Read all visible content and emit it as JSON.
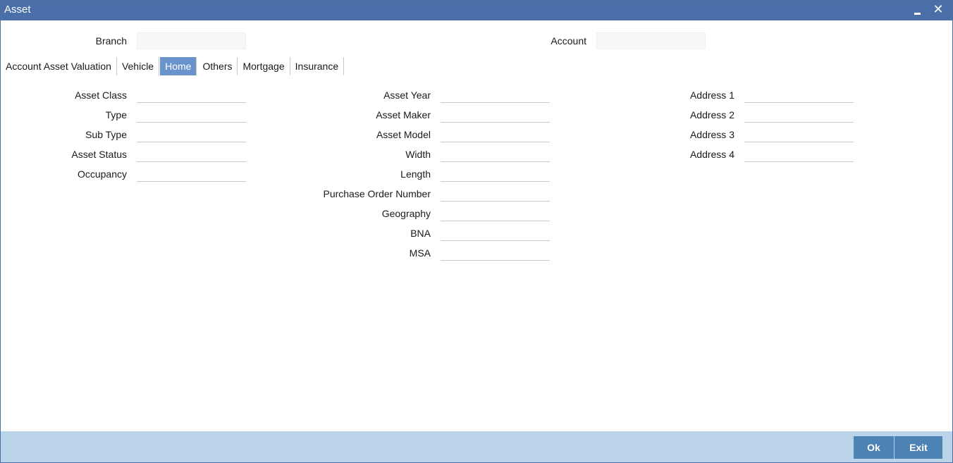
{
  "window": {
    "title": "Asset",
    "minimize_icon": "minimize-icon",
    "close_icon": "close-icon",
    "close_glyph": "✕"
  },
  "header": {
    "branch_label": "Branch",
    "branch_value": "",
    "account_label": "Account",
    "account_value": ""
  },
  "tabs": [
    {
      "label": "Account Asset Valuation",
      "active": false
    },
    {
      "label": "Vehicle",
      "active": false
    },
    {
      "label": "Home",
      "active": true
    },
    {
      "label": "Others",
      "active": false
    },
    {
      "label": "Mortgage",
      "active": false
    },
    {
      "label": "Insurance",
      "active": false
    }
  ],
  "form": {
    "col1": [
      {
        "label": "Asset Class",
        "value": ""
      },
      {
        "label": "Type",
        "value": ""
      },
      {
        "label": "Sub Type",
        "value": ""
      },
      {
        "label": "Asset Status",
        "value": ""
      },
      {
        "label": "Occupancy",
        "value": ""
      }
    ],
    "col2": [
      {
        "label": "Asset Year",
        "value": ""
      },
      {
        "label": "Asset Maker",
        "value": ""
      },
      {
        "label": "Asset Model",
        "value": ""
      },
      {
        "label": "Width",
        "value": ""
      },
      {
        "label": "Length",
        "value": ""
      },
      {
        "label": "Purchase Order Number",
        "value": ""
      },
      {
        "label": "Geography",
        "value": ""
      },
      {
        "label": "BNA",
        "value": ""
      },
      {
        "label": "MSA",
        "value": ""
      }
    ],
    "col3": [
      {
        "label": "Address 1",
        "value": ""
      },
      {
        "label": "Address 2",
        "value": ""
      },
      {
        "label": "Address 3",
        "value": ""
      },
      {
        "label": "Address 4",
        "value": ""
      }
    ]
  },
  "footer": {
    "ok_label": "Ok",
    "exit_label": "Exit"
  },
  "colors": {
    "titlebar": "#4a6fa8",
    "active_tab": "#6a93cc",
    "footer": "#bcd4ea",
    "button": "#4d82b4"
  }
}
